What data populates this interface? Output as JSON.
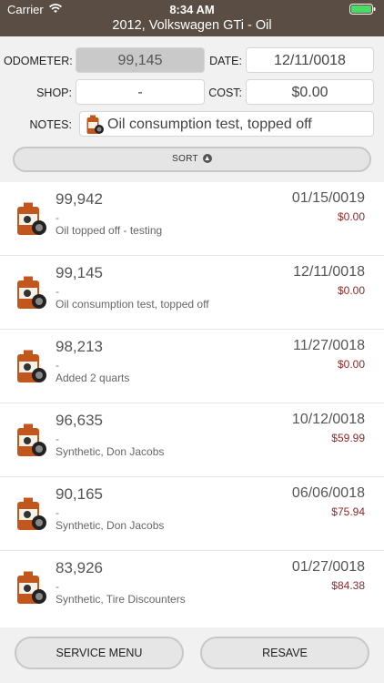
{
  "status": {
    "carrier": "Carrier",
    "time": "8:34 AM"
  },
  "title": "2012, Volkswagen GTi - Oil",
  "form": {
    "odometer_label": "ODOMETER:",
    "odometer_value": "99,145",
    "date_label": "DATE:",
    "date_value": "12/11/0018",
    "shop_label": "SHOP:",
    "shop_value": "-",
    "cost_label": "COST:",
    "cost_value": "$0.00",
    "notes_label": "NOTES:",
    "notes_value": "Oil consumption test, topped off"
  },
  "sort_label": "SORT",
  "entries": [
    {
      "odometer": "99,942",
      "shop": "-",
      "note": "Oil topped off - testing",
      "date": "01/15/0019",
      "cost": "$0.00"
    },
    {
      "odometer": "99,145",
      "shop": "-",
      "note": "Oil consumption test, topped off",
      "date": "12/11/0018",
      "cost": "$0.00"
    },
    {
      "odometer": "98,213",
      "shop": "-",
      "note": "Added 2 quarts",
      "date": "11/27/0018",
      "cost": "$0.00"
    },
    {
      "odometer": "96,635",
      "shop": "-",
      "note": "Synthetic, Don Jacobs",
      "date": "10/12/0018",
      "cost": "$59.99"
    },
    {
      "odometer": "90,165",
      "shop": "-",
      "note": "Synthetic, Don Jacobs",
      "date": "06/06/0018",
      "cost": "$75.94"
    },
    {
      "odometer": "83,926",
      "shop": "-",
      "note": "Synthetic, Tire Discounters",
      "date": "01/27/0018",
      "cost": "$84.38"
    }
  ],
  "buttons": {
    "service_menu": "SERVICE MENU",
    "resave": "RESAVE"
  },
  "colors": {
    "header": "#5a4d43",
    "cost": "#8b2a2a",
    "oil_icon": "#c2571e"
  }
}
